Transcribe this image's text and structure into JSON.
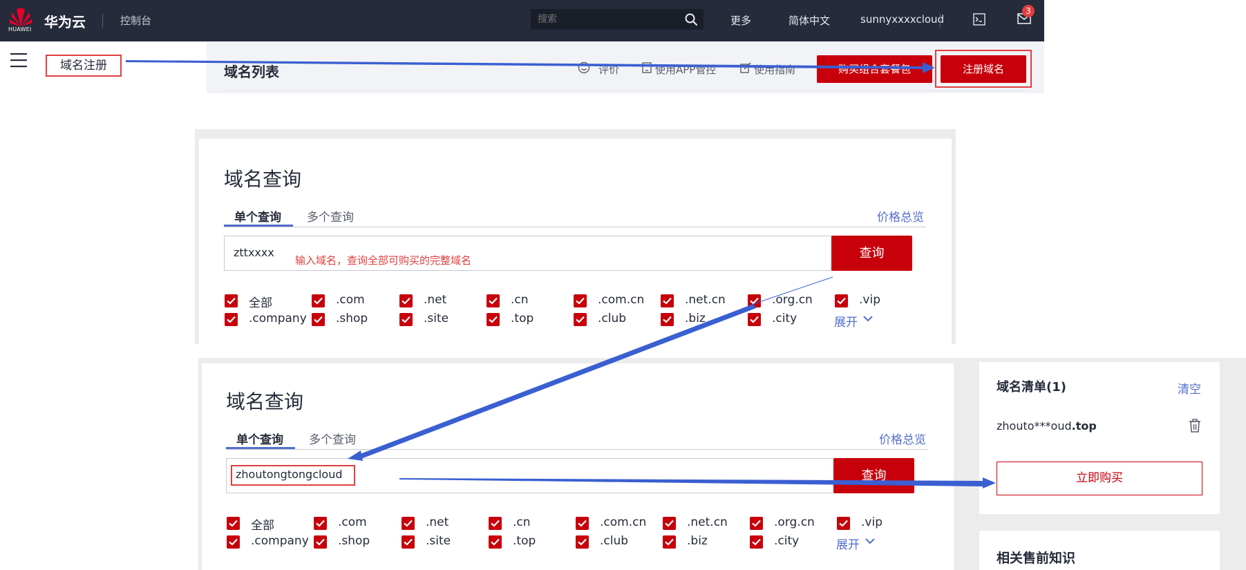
{
  "header": {
    "logo_text": "HUAWEI",
    "brand": "华为云",
    "console": "控制台",
    "search_placeholder": "搜索",
    "more": "更多",
    "language": "简体中文",
    "username": "sunnyxxxxcloud",
    "mail_count": "3",
    "icons": {
      "search": "search-icon",
      "terminal": "terminal-icon",
      "mail": "mail-icon"
    }
  },
  "sidebar": {
    "item_label": "域名注册",
    "menu_icon": "hamburger-icon"
  },
  "domain_list": {
    "title": "域名列表",
    "rate": "评价",
    "app_manage": "使用APP管控",
    "guide": "使用指南",
    "buy_package": "购买组合套餐包",
    "register": "注册域名"
  },
  "query_panel_1": {
    "title": "域名查询",
    "tab_single": "单个查询",
    "tab_multi": "多个查询",
    "price_overview": "价格总览",
    "input_value": "zttxxxx",
    "hint": "输入域名，查询全部可购买的完整域名",
    "query_button": "查询",
    "suffixes_row1": [
      "全部",
      ".com",
      ".net",
      ".cn",
      ".com.cn",
      ".net.cn",
      ".org.cn",
      ".vip"
    ],
    "suffixes_row2": [
      ".company",
      ".shop",
      ".site",
      ".top",
      ".club",
      ".biz",
      ".city"
    ],
    "expand": "展开"
  },
  "query_panel_2": {
    "title": "域名查询",
    "tab_single": "单个查询",
    "tab_multi": "多个查询",
    "price_overview": "价格总览",
    "input_value": "zhoutongtongcloud",
    "query_button": "查询",
    "suffixes_row1": [
      "全部",
      ".com",
      ".net",
      ".cn",
      ".com.cn",
      ".net.cn",
      ".org.cn",
      ".vip"
    ],
    "suffixes_row2": [
      ".company",
      ".shop",
      ".site",
      ".top",
      ".club",
      ".biz",
      ".city"
    ],
    "expand": "展开"
  },
  "cart": {
    "title": "域名清单(1)",
    "clear": "清空",
    "item_prefix": "zhouto***oud",
    "item_suffix": ".top",
    "buy_now": "立即购买",
    "presale": "相关售前知识"
  },
  "colors": {
    "brand_red": "#c7000b",
    "link_blue": "#526ecc",
    "arrow_blue": "#3a5fd1",
    "annotation_red": "#e03e3e",
    "topbar": "#252b3a"
  }
}
